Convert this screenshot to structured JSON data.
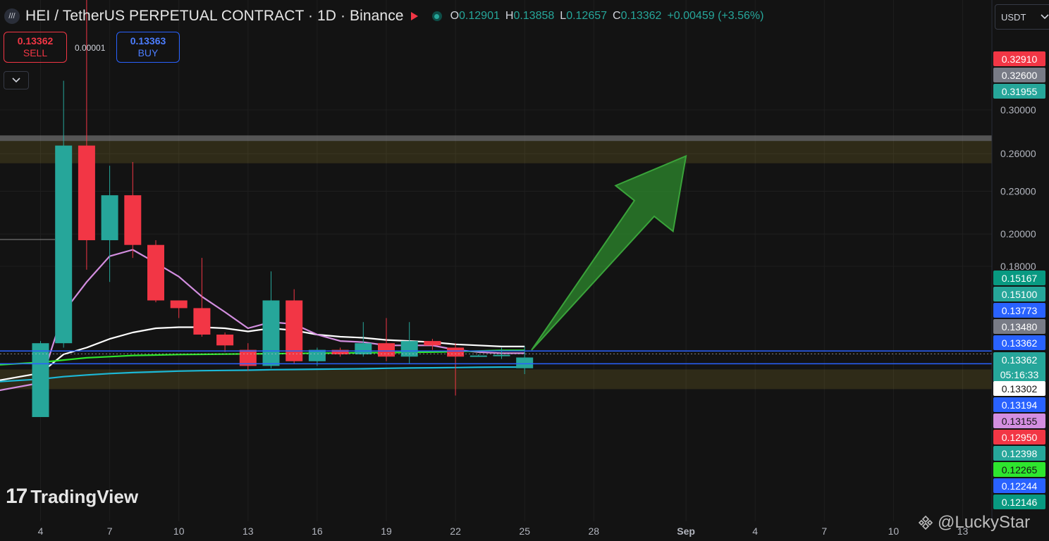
{
  "header": {
    "symbol_icon": "binance-pair-icon",
    "title": "HEI / TetherUS PERPETUAL CONTRACT · 1D · Binance",
    "ohlc": [
      {
        "k": "O",
        "v": "0.12901"
      },
      {
        "k": "H",
        "v": "0.13858"
      },
      {
        "k": "L",
        "v": "0.12657"
      },
      {
        "k": "C",
        "v": "0.13362"
      }
    ],
    "change": "+0.00459 (+3.56%)",
    "currency": "USDT"
  },
  "trade": {
    "sell_price": "0.13362",
    "sell_label": "SELL",
    "buy_price": "0.13363",
    "buy_label": "BUY",
    "spread": "0.00001"
  },
  "watermark": "TradingView",
  "credit": "@LuckyStar",
  "colors": {
    "background": "#131313",
    "up": "#26a69a",
    "down": "#f23645",
    "ma_fast": "#ffffff",
    "ma_purple": "#d38ee0",
    "ma_green": "#2ee62e",
    "ma_cyan": "#1cb8d6",
    "level_line": "#2962ff",
    "zone": "#f2d43a",
    "arrow": "#2e8b2e"
  },
  "chart_data": {
    "type": "candlestick",
    "y_scale": "log",
    "y_tick_labels": [
      "0.30000",
      "0.26000",
      "0.23000",
      "0.20000",
      "0.18000"
    ],
    "x_tick_labels": [
      {
        "label": "4",
        "day": 4
      },
      {
        "label": "7",
        "day": 7
      },
      {
        "label": "10",
        "day": 10
      },
      {
        "label": "13",
        "day": 13
      },
      {
        "label": "16",
        "day": 16
      },
      {
        "label": "19",
        "day": 19
      },
      {
        "label": "22",
        "day": 22
      },
      {
        "label": "25",
        "day": 25
      },
      {
        "label": "28",
        "day": 28
      },
      {
        "label": "Sep",
        "day": 32
      },
      {
        "label": "4",
        "day": 35
      },
      {
        "label": "7",
        "day": 38
      },
      {
        "label": "10",
        "day": 41
      },
      {
        "label": "13",
        "day": 44
      }
    ],
    "candles": [
      {
        "day": 4,
        "o": 0.11,
        "h": 0.141,
        "l": 0.11,
        "c": 0.14
      },
      {
        "day": 5,
        "o": 0.14,
        "h": 0.33,
        "l": 0.138,
        "c": 0.267
      },
      {
        "day": 6,
        "o": 0.267,
        "h": 0.52,
        "l": 0.178,
        "c": 0.196
      },
      {
        "day": 7,
        "o": 0.196,
        "h": 0.25,
        "l": 0.171,
        "c": 0.227
      },
      {
        "day": 8,
        "o": 0.227,
        "h": 0.253,
        "l": 0.185,
        "c": 0.193
      },
      {
        "day": 9,
        "o": 0.193,
        "h": 0.196,
        "l": 0.16,
        "c": 0.161
      },
      {
        "day": 10,
        "o": 0.161,
        "h": 0.161,
        "l": 0.152,
        "c": 0.157
      },
      {
        "day": 11,
        "o": 0.157,
        "h": 0.185,
        "l": 0.143,
        "c": 0.144
      },
      {
        "day": 12,
        "o": 0.144,
        "h": 0.145,
        "l": 0.136,
        "c": 0.139
      },
      {
        "day": 13,
        "o": 0.137,
        "h": 0.14,
        "l": 0.128,
        "c": 0.13
      },
      {
        "day": 14,
        "o": 0.13,
        "h": 0.177,
        "l": 0.129,
        "c": 0.161
      },
      {
        "day": 15,
        "o": 0.161,
        "h": 0.167,
        "l": 0.131,
        "c": 0.132
      },
      {
        "day": 16,
        "o": 0.132,
        "h": 0.138,
        "l": 0.13,
        "c": 0.137
      },
      {
        "day": 17,
        "o": 0.137,
        "h": 0.138,
        "l": 0.134,
        "c": 0.135
      },
      {
        "day": 18,
        "o": 0.135,
        "h": 0.15,
        "l": 0.134,
        "c": 0.14
      },
      {
        "day": 19,
        "o": 0.14,
        "h": 0.152,
        "l": 0.132,
        "c": 0.134
      },
      {
        "day": 20,
        "o": 0.134,
        "h": 0.15,
        "l": 0.131,
        "c": 0.141
      },
      {
        "day": 21,
        "o": 0.141,
        "h": 0.142,
        "l": 0.137,
        "c": 0.139
      },
      {
        "day": 22,
        "o": 0.138,
        "h": 0.14,
        "l": 0.118,
        "c": 0.134
      },
      {
        "day": 23,
        "o": 0.134,
        "h": 0.135,
        "l": 0.134,
        "c": 0.1345
      },
      {
        "day": 24,
        "o": 0.1345,
        "h": 0.138,
        "l": 0.133,
        "c": 0.1348
      },
      {
        "day": 25,
        "o": 0.12901,
        "h": 0.13858,
        "l": 0.12657,
        "c": 0.13362
      }
    ],
    "moving_averages": [
      {
        "color": "#ffffff",
        "points": [
          [
            3,
            0.124
          ],
          [
            4,
            0.127
          ],
          [
            5,
            0.135
          ],
          [
            6,
            0.138
          ],
          [
            7,
            0.142
          ],
          [
            8,
            0.145
          ],
          [
            9,
            0.147
          ],
          [
            10,
            0.1475
          ],
          [
            11,
            0.1475
          ],
          [
            12,
            0.147
          ],
          [
            13,
            0.1455
          ],
          [
            14,
            0.147
          ],
          [
            15,
            0.146
          ],
          [
            16,
            0.144
          ],
          [
            17,
            0.143
          ],
          [
            18,
            0.1425
          ],
          [
            19,
            0.1415
          ],
          [
            20,
            0.141
          ],
          [
            21,
            0.1405
          ],
          [
            22,
            0.1395
          ],
          [
            23,
            0.139
          ],
          [
            24,
            0.1385
          ],
          [
            25,
            0.138
          ]
        ]
      },
      {
        "color": "#d38ee0",
        "points": [
          [
            3,
            0.12
          ],
          [
            4,
            0.123
          ],
          [
            5,
            0.155
          ],
          [
            6,
            0.171
          ],
          [
            7,
            0.186
          ],
          [
            8,
            0.19
          ],
          [
            9,
            0.182
          ],
          [
            10,
            0.174
          ],
          [
            11,
            0.163
          ],
          [
            12,
            0.155
          ],
          [
            13,
            0.147
          ],
          [
            14,
            0.15
          ],
          [
            15,
            0.149
          ],
          [
            16,
            0.144
          ],
          [
            17,
            0.141
          ],
          [
            18,
            0.1405
          ],
          [
            19,
            0.139
          ],
          [
            20,
            0.139
          ],
          [
            21,
            0.139
          ],
          [
            22,
            0.137
          ],
          [
            23,
            0.136
          ],
          [
            24,
            0.1355
          ],
          [
            25,
            0.13155
          ]
        ]
      },
      {
        "color": "#2ee62e",
        "points": [
          [
            3,
            0.1305
          ],
          [
            4,
            0.1315
          ],
          [
            5,
            0.1325
          ],
          [
            6,
            0.1335
          ],
          [
            7,
            0.134
          ],
          [
            8,
            0.1345
          ],
          [
            9,
            0.1347
          ],
          [
            10,
            0.1349
          ],
          [
            11,
            0.135
          ],
          [
            12,
            0.1351
          ],
          [
            13,
            0.1352
          ],
          [
            14,
            0.1353
          ],
          [
            15,
            0.1354
          ],
          [
            16,
            0.1355
          ],
          [
            17,
            0.1356
          ],
          [
            18,
            0.1357
          ],
          [
            19,
            0.1358
          ],
          [
            20,
            0.1359
          ],
          [
            21,
            0.136
          ],
          [
            22,
            0.1362
          ],
          [
            23,
            0.1365
          ],
          [
            24,
            0.1368
          ],
          [
            25,
            0.12265
          ]
        ]
      },
      {
        "color": "#1cb8d6",
        "points": [
          [
            3,
            0.1235
          ],
          [
            4,
            0.1245
          ],
          [
            5,
            0.1255
          ],
          [
            6,
            0.1262
          ],
          [
            7,
            0.1268
          ],
          [
            8,
            0.1272
          ],
          [
            9,
            0.1275
          ],
          [
            10,
            0.1278
          ],
          [
            11,
            0.128
          ],
          [
            12,
            0.1281
          ],
          [
            13,
            0.1282
          ],
          [
            14,
            0.1284
          ],
          [
            15,
            0.1285
          ],
          [
            16,
            0.1286
          ],
          [
            17,
            0.1287
          ],
          [
            18,
            0.1288
          ],
          [
            19,
            0.129
          ],
          [
            20,
            0.1291
          ],
          [
            21,
            0.1292
          ],
          [
            22,
            0.1293
          ],
          [
            23,
            0.1294
          ],
          [
            24,
            0.1295
          ],
          [
            25,
            0.12146
          ]
        ]
      }
    ],
    "horizontal_lines": [
      {
        "value": 0.1365,
        "color": "#2962ff",
        "label": "0.13362"
      },
      {
        "value": 0.1309,
        "color": "#2962ff",
        "label": "0.13302"
      }
    ],
    "zones": [
      {
        "from": 0.271,
        "to": 0.276,
        "color": "#8c8c8c",
        "note": ""
      },
      {
        "from": 0.252,
        "to": 0.271,
        "color": "#f2d43a",
        "note": ""
      },
      {
        "from": 0.1205,
        "to": 0.1285,
        "color": "#f2d43a",
        "note": ""
      }
    ],
    "projection_arrow": {
      "from": [
        25.3,
        0.1369
      ],
      "to": [
        32,
        0.258
      ]
    },
    "price_labels": [
      {
        "text": "0.32910",
        "bg": "#f23645",
        "fg": "#ffffff"
      },
      {
        "text": "0.32600",
        "bg": "#787b86",
        "fg": "#ffffff"
      },
      {
        "text": "0.31955",
        "bg": "#26a69a",
        "fg": "#ffffff"
      },
      {
        "text": "0.15167",
        "bg": "#089981",
        "fg": "#ffffff"
      },
      {
        "text": "0.15100",
        "bg": "#26a69a",
        "fg": "#ffffff"
      },
      {
        "text": "0.13773",
        "bg": "#2962ff",
        "fg": "#ffffff"
      },
      {
        "text": "0.13480",
        "bg": "#787b86",
        "fg": "#ffffff"
      },
      {
        "text": "0.13362",
        "bg": "#2962ff",
        "fg": "#ffffff"
      },
      {
        "text": "0.13362",
        "bg": "#26a69a",
        "fg": "#ffffff",
        "sub": "05:16:33"
      },
      {
        "text": "0.13302",
        "bg": "#ffffff",
        "fg": "#131313"
      },
      {
        "text": "0.13194",
        "bg": "#2962ff",
        "fg": "#ffffff"
      },
      {
        "text": "0.13155",
        "bg": "#d38ee0",
        "fg": "#131313"
      },
      {
        "text": "0.12950",
        "bg": "#f23645",
        "fg": "#ffffff"
      },
      {
        "text": "0.12398",
        "bg": "#26a69a",
        "fg": "#ffffff"
      },
      {
        "text": "0.12265",
        "bg": "#2ee62e",
        "fg": "#131313"
      },
      {
        "text": "0.12244",
        "bg": "#2962ff",
        "fg": "#ffffff"
      },
      {
        "text": "0.12146",
        "bg": "#089981",
        "fg": "#ffffff"
      }
    ]
  }
}
